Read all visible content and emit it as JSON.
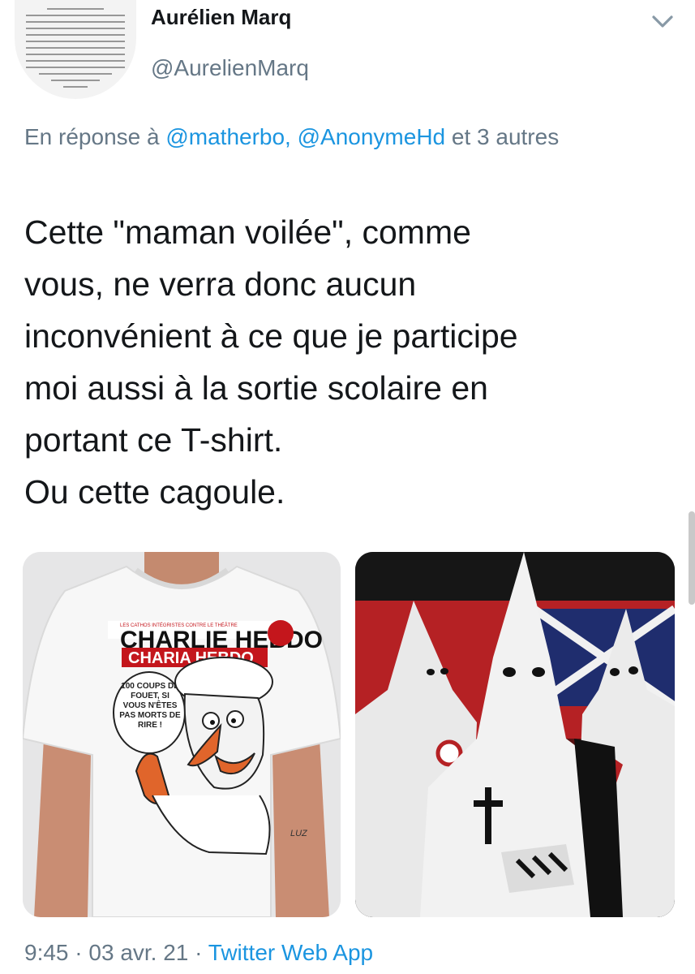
{
  "tweet": {
    "author_name": "Aurélien Marq",
    "author_handle": "@AurelienMarq",
    "reply_prefix": "En réponse à ",
    "reply_mentions": "@matherbo, @AnonymeHd",
    "reply_suffix": " et 3 autres",
    "text": "Cette \"maman voilée\", comme\nvous, ne verra donc aucun\ninconvénient à ce que je participe\nmoi aussi à la sortie scolaire en\nportant ce T-shirt.\nOu cette cagoule.",
    "time": "9:45",
    "date": "03 avr. 21",
    "separator": " · ",
    "source": "Twitter Web App"
  },
  "media": {
    "tshirt": {
      "top_line": "LES CATHOS INTÉGRISTES CONTRE LE THÉÂTRE",
      "masthead": "CHARLIE HEBDO",
      "banner": "CHARIA HEBDO",
      "bubble": "100 COUPS DE FOUET, SI VOUS N'ÊTES PAS MORTS DE RIRE !",
      "signature": "LUZ"
    }
  },
  "icons": {
    "more": "chevron-down-icon"
  },
  "colors": {
    "link": "#1b95e0",
    "secondary": "#657786",
    "text": "#14171a"
  }
}
